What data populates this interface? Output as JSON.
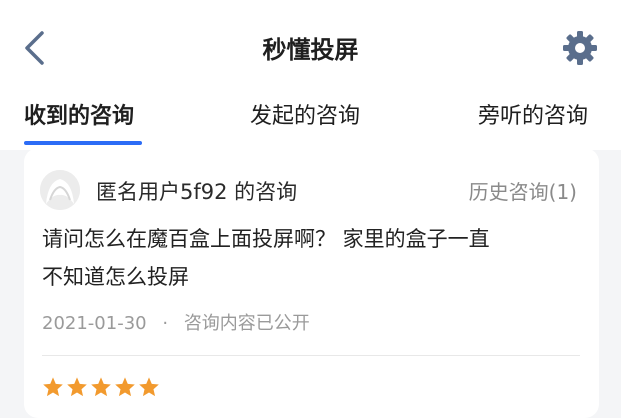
{
  "header": {
    "title": "秒懂投屏",
    "back_icon": "chevron-left-icon",
    "settings_icon": "gear-icon",
    "icon_color": "#5a6e8c"
  },
  "tabs": [
    {
      "label": "收到的咨询",
      "active": true
    },
    {
      "label": "发起的咨询",
      "active": false
    },
    {
      "label": "旁听的咨询",
      "active": false
    }
  ],
  "accent_color": "#2c6cf6",
  "consultation": {
    "user_label": "匿名用户5f92 的咨询",
    "history_label": "历史咨询(1)",
    "question_line1": "请问怎么在魔百盒上面投屏啊？ 家里的盒子一直",
    "question_line2": "不知道怎么投屏",
    "date": "2021-01-30",
    "separator": "·",
    "visibility": "咨询内容已公开",
    "rating": 5,
    "star_color": "#f29a2e"
  }
}
